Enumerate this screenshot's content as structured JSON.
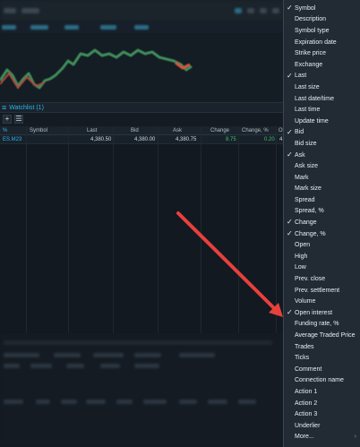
{
  "watchlist": {
    "title": "Watchlist (1)",
    "toolbar": {
      "add_label": "+",
      "list_label": "☰"
    },
    "columns": [
      "%",
      "Symbol",
      "Last",
      "Bid",
      "Ask",
      "Change",
      "Change, %",
      "O"
    ],
    "row": {
      "symbol": "ES.M23",
      "last": "4,380.50",
      "bid": "4,380.00",
      "ask": "4,380.75",
      "change": "8.75",
      "change_pct": "0.20",
      "open_partial": "4,"
    }
  },
  "menu": {
    "items": [
      {
        "label": "Symbol",
        "checked": true
      },
      {
        "label": "Description",
        "checked": false
      },
      {
        "label": "Symbol type",
        "checked": false
      },
      {
        "label": "Expiration date",
        "checked": false
      },
      {
        "label": "Strike price",
        "checked": false
      },
      {
        "label": "Exchange",
        "checked": false
      },
      {
        "label": "Last",
        "checked": true
      },
      {
        "label": "Last size",
        "checked": false
      },
      {
        "label": "Last date/time",
        "checked": false
      },
      {
        "label": "Last time",
        "checked": false
      },
      {
        "label": "Update time",
        "checked": false
      },
      {
        "label": "Bid",
        "checked": true
      },
      {
        "label": "Bid size",
        "checked": false
      },
      {
        "label": "Ask",
        "checked": true
      },
      {
        "label": "Ask size",
        "checked": false
      },
      {
        "label": "Mark",
        "checked": false
      },
      {
        "label": "Mark size",
        "checked": false
      },
      {
        "label": "Spread",
        "checked": false
      },
      {
        "label": "Spread, %",
        "checked": false
      },
      {
        "label": "Change",
        "checked": true
      },
      {
        "label": "Change, %",
        "checked": true
      },
      {
        "label": "Open",
        "checked": false
      },
      {
        "label": "High",
        "checked": false
      },
      {
        "label": "Low",
        "checked": false
      },
      {
        "label": "Prev. close",
        "checked": false
      },
      {
        "label": "Prev. settlement",
        "checked": false
      },
      {
        "label": "Volume",
        "checked": false
      },
      {
        "label": "Open interest",
        "checked": true
      },
      {
        "label": "Funding rate, %",
        "checked": false
      },
      {
        "label": "Average Traded Price",
        "checked": false
      },
      {
        "label": "Trades",
        "checked": false
      },
      {
        "label": "Ticks",
        "checked": false
      },
      {
        "label": "Comment",
        "checked": false
      },
      {
        "label": "Connection name",
        "checked": false
      },
      {
        "label": "Action 1",
        "checked": false
      },
      {
        "label": "Action 2",
        "checked": false
      },
      {
        "label": "Action 3",
        "checked": false
      },
      {
        "label": "Underlier",
        "checked": false
      },
      {
        "label": "More...",
        "checked": false,
        "submenu": true
      }
    ],
    "check_glyph": "✓",
    "submenu_glyph": "›"
  },
  "colors": {
    "accent": "#29b6e8",
    "arrow": "#e8403c",
    "positive": "#3fbf6a",
    "menu_bg": "#222b34"
  }
}
